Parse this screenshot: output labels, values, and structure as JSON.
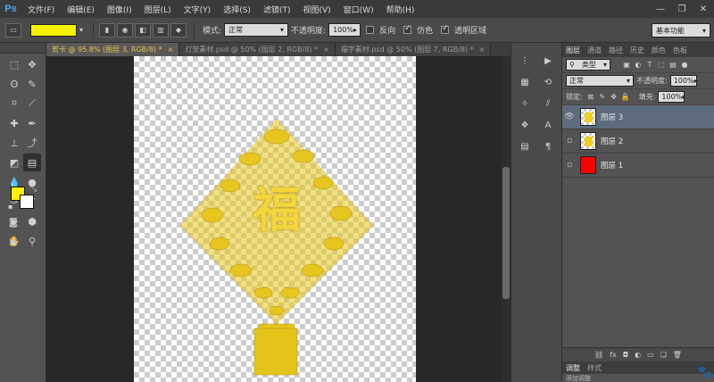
{
  "app": {
    "logo": "Ps"
  },
  "menu": [
    "文件(F)",
    "编辑(E)",
    "图像(I)",
    "图层(L)",
    "文字(Y)",
    "选择(S)",
    "滤镜(T)",
    "视图(V)",
    "窗口(W)",
    "帮助(H)"
  ],
  "window_controls": {
    "minimize": "—",
    "restore": "❐",
    "close": "✕"
  },
  "options": {
    "gradient_color": "#f4f000",
    "mode_label": "模式:",
    "mode_value": "正常",
    "opacity_label": "不透明度:",
    "opacity_value": "100%",
    "reverse_label": "反向",
    "dither_label": "仿色",
    "transparency_label": "透明区域",
    "workspace": "基本功能"
  },
  "tabs": [
    {
      "label": "贺卡 @ 95.8% (图层 3, RGB/8) *"
    },
    {
      "label": "灯笼素材.psd @ 50% (图层 2, RGB/8) *"
    },
    {
      "label": "福字素材.psd @ 50% (图层 7, RGB/8) *"
    }
  ],
  "colors": {
    "foreground": "#ffef00",
    "background": "#ffffff"
  },
  "layers_panel": {
    "tabs": [
      "图层",
      "通道",
      "路径",
      "历史",
      "颜色",
      "色板"
    ],
    "filter_kind": "类型",
    "blend_mode": "正常",
    "opacity_label": "不透明度:",
    "opacity_value": "100%",
    "lock_label": "锁定:",
    "fill_label": "填充:",
    "fill_value": "100%",
    "layers": [
      {
        "name": "图层 3",
        "visible": true,
        "selected": true
      },
      {
        "name": "图层 2",
        "visible": false,
        "selected": false
      },
      {
        "name": "图层 1",
        "visible": false,
        "selected": false
      }
    ]
  },
  "lower_panel": {
    "tabs": [
      "调整",
      "样式"
    ],
    "content": "添加调整"
  }
}
